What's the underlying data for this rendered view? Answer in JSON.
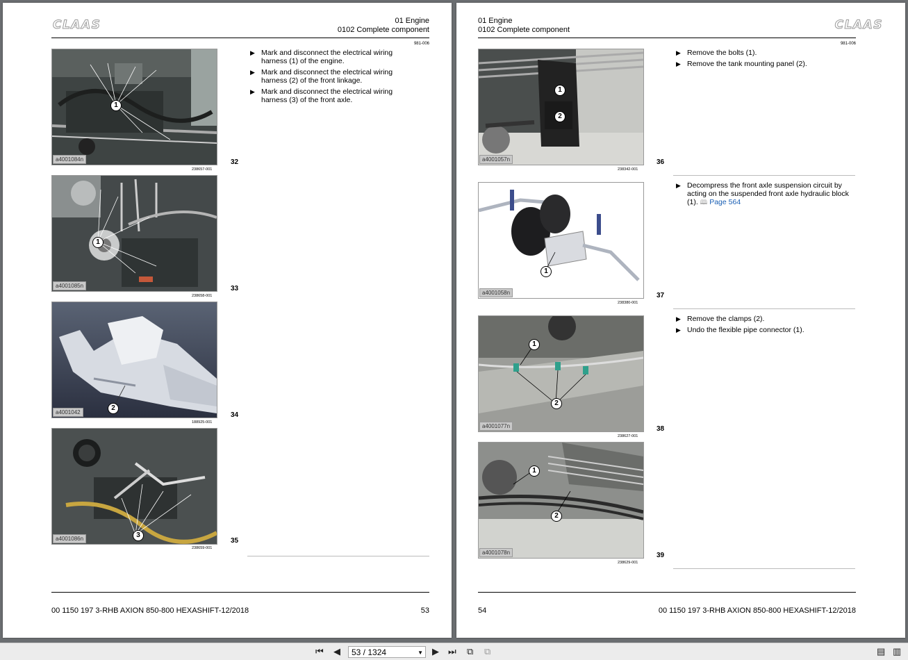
{
  "viewer": {
    "page_indicator": "53 / 1324",
    "buttons": {
      "first": "first-page",
      "prev": "previous-page",
      "next": "next-page",
      "last": "last-page",
      "fit_page": "fit-page",
      "fit_width": "fit-width",
      "single": "single-page-view",
      "double": "two-page-view"
    }
  },
  "brand": "CLAAS",
  "left_page": {
    "header_line1": "01 Engine",
    "header_line2": "0102 Complete component",
    "doc_code": "981-006",
    "steps": [
      "Mark and disconnect the electrical wiring harness (1) of the engine.",
      "Mark and disconnect the electrical wiring harness (2) of the front linkage.",
      "Mark and disconnect the electrical wiring harness (3) of the front axle."
    ],
    "figures": [
      {
        "tag": "a4001084n",
        "num": "32",
        "ref": "238657-001",
        "callout": "1"
      },
      {
        "tag": "a4001085n",
        "num": "33",
        "ref": "238658-001",
        "callout": "1"
      },
      {
        "tag": "a4001042",
        "num": "34",
        "ref": "188925-001",
        "callout": "2"
      },
      {
        "tag": "a4001086n",
        "num": "35",
        "ref": "238659-001",
        "callout": "3"
      }
    ],
    "footer_left": "00 1150 197 3-RHB AXION 850-800 HEXASHIFT-12/2018",
    "page_number": "53"
  },
  "right_page": {
    "header_line1": "01 Engine",
    "header_line2": "0102 Complete component",
    "doc_code": "981-006",
    "groups": [
      {
        "steps": [
          "Remove the bolts (1).",
          "Remove the tank mounting panel (2)."
        ]
      },
      {
        "steps": [
          "Decompress the front axle suspension circuit by acting on the suspended front axle hydraulic block (1)."
        ],
        "link_prefix": "Page",
        "link_page": "564"
      },
      {
        "steps": [
          "Remove the clamps (2).",
          "Undo the flexible pipe connector (1)."
        ]
      }
    ],
    "figures": [
      {
        "tag": "a4001057n",
        "num": "36",
        "ref": "238342-001",
        "callouts": [
          "1",
          "2"
        ]
      },
      {
        "tag": "a4001058n",
        "num": "37",
        "ref": "238380-001",
        "callouts": [
          "1"
        ]
      },
      {
        "tag": "a4001077n",
        "num": "38",
        "ref": "238627-001",
        "callouts": [
          "1",
          "2"
        ]
      },
      {
        "tag": "a4001078n",
        "num": "39",
        "ref": "238629-001",
        "callouts": [
          "1",
          "2"
        ]
      }
    ],
    "footer_left": "54",
    "footer_right": "00 1150 197 3-RHB AXION 850-800 HEXASHIFT-12/2018"
  }
}
